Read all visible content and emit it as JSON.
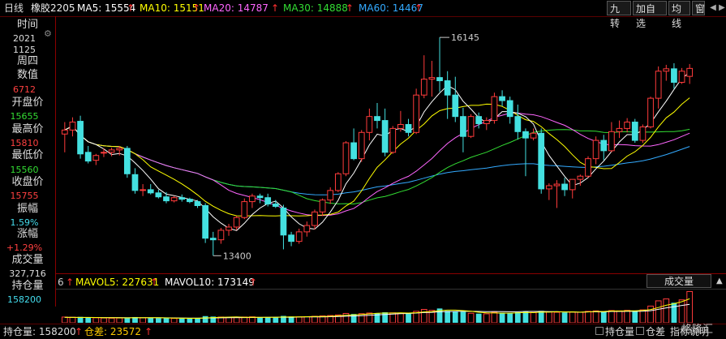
{
  "header": {
    "period": "日线",
    "symbol": "橡胶2205",
    "ma": [
      {
        "label": "MA5: 15554",
        "color": "#ffffff"
      },
      {
        "label": "MA10: 15151",
        "color": "#ffff00"
      },
      {
        "label": "MA20: 14787",
        "color": "#ff66ff"
      },
      {
        "label": "MA30: 14888",
        "color": "#33dd33"
      },
      {
        "label": "MA60: 14467",
        "color": "#33aaff"
      }
    ],
    "buttons": [
      "九转",
      "加自选",
      "均线",
      "窗"
    ]
  },
  "sidebar": {
    "time_label": "时间",
    "year": "2021",
    "date": "1125",
    "weekday": "周四",
    "value_label": "数值",
    "value": "6712",
    "open_label": "开盘价",
    "open": "15655",
    "high_label": "最高价",
    "high": "15810",
    "low_label": "最低价",
    "low": "15560",
    "close_label": "收盘价",
    "close": "15755",
    "amp_label": "振幅",
    "amp": "1.59%",
    "chg_label": "涨幅",
    "chg": "+1.29%",
    "vol_label": "成交量",
    "vol": "327,716",
    "oi_label": "持仓量",
    "oi": "158200"
  },
  "volume": {
    "prefix": "6",
    "mavol5": "MAVOL5: 227631",
    "mavol10": "MAVOL10: 173149",
    "indicator": "成交量"
  },
  "bottom": {
    "oi_text": "持仓量: 158200",
    "oi_change_text": "仓差: 23572",
    "oi_checkbox": "持仓量",
    "vol_checkbox": "仓差",
    "help": "指标说明",
    "brand": "格隆汇"
  },
  "colors": {
    "up": "#ff3b3b",
    "down": "#44e0e0",
    "ma5": "#ffffff",
    "ma10": "#ffff00",
    "ma20": "#ff66ff",
    "ma30": "#33dd33",
    "ma60": "#33aaff"
  },
  "chart_data": {
    "type": "candlestick",
    "annotations": [
      {
        "text": "16145",
        "price": 16145
      },
      {
        "text": "13400",
        "price": 13400
      }
    ],
    "price_range": [
      13250,
      16350
    ],
    "candles": [
      {
        "o": 14930,
        "h": 15080,
        "l": 14700,
        "c": 14980
      },
      {
        "o": 14980,
        "h": 15140,
        "l": 14900,
        "c": 15080
      },
      {
        "o": 15090,
        "h": 15160,
        "l": 14620,
        "c": 14680
      },
      {
        "o": 14700,
        "h": 14780,
        "l": 14560,
        "c": 14590
      },
      {
        "o": 14600,
        "h": 14680,
        "l": 14540,
        "c": 14660
      },
      {
        "o": 14690,
        "h": 14750,
        "l": 14640,
        "c": 14700
      },
      {
        "o": 14700,
        "h": 14760,
        "l": 14650,
        "c": 14730
      },
      {
        "o": 14730,
        "h": 14780,
        "l": 14660,
        "c": 14750
      },
      {
        "o": 14750,
        "h": 14780,
        "l": 14380,
        "c": 14430
      },
      {
        "o": 14420,
        "h": 14500,
        "l": 14180,
        "c": 14220
      },
      {
        "o": 14220,
        "h": 14300,
        "l": 14150,
        "c": 14230
      },
      {
        "o": 14230,
        "h": 14300,
        "l": 14170,
        "c": 14190
      },
      {
        "o": 14190,
        "h": 14230,
        "l": 14120,
        "c": 14140
      },
      {
        "o": 14140,
        "h": 14200,
        "l": 14060,
        "c": 14090
      },
      {
        "o": 14090,
        "h": 14150,
        "l": 14070,
        "c": 14130
      },
      {
        "o": 14130,
        "h": 14170,
        "l": 14080,
        "c": 14110
      },
      {
        "o": 14110,
        "h": 14130,
        "l": 14060,
        "c": 14080
      },
      {
        "o": 14080,
        "h": 14100,
        "l": 14000,
        "c": 14030
      },
      {
        "o": 14030,
        "h": 14060,
        "l": 13560,
        "c": 13620
      },
      {
        "o": 13620,
        "h": 13700,
        "l": 13400,
        "c": 13600
      },
      {
        "o": 13600,
        "h": 13750,
        "l": 13550,
        "c": 13720
      },
      {
        "o": 13720,
        "h": 13800,
        "l": 13650,
        "c": 13760
      },
      {
        "o": 13760,
        "h": 13900,
        "l": 13720,
        "c": 13880
      },
      {
        "o": 13880,
        "h": 14120,
        "l": 13860,
        "c": 14080
      },
      {
        "o": 14080,
        "h": 14180,
        "l": 14000,
        "c": 14150
      },
      {
        "o": 14150,
        "h": 14180,
        "l": 14060,
        "c": 14130
      },
      {
        "o": 14130,
        "h": 14180,
        "l": 14020,
        "c": 14050
      },
      {
        "o": 14050,
        "h": 14100,
        "l": 14000,
        "c": 14020
      },
      {
        "o": 14000,
        "h": 14040,
        "l": 13480,
        "c": 13660
      },
      {
        "o": 13660,
        "h": 13700,
        "l": 13520,
        "c": 13580
      },
      {
        "o": 13580,
        "h": 13740,
        "l": 13550,
        "c": 13700
      },
      {
        "o": 13700,
        "h": 13830,
        "l": 13640,
        "c": 13780
      },
      {
        "o": 13780,
        "h": 13980,
        "l": 13730,
        "c": 13950
      },
      {
        "o": 13950,
        "h": 14120,
        "l": 13900,
        "c": 14100
      },
      {
        "o": 14100,
        "h": 14260,
        "l": 14050,
        "c": 14220
      },
      {
        "o": 14220,
        "h": 14450,
        "l": 14200,
        "c": 14430
      },
      {
        "o": 14430,
        "h": 14840,
        "l": 14400,
        "c": 14820
      },
      {
        "o": 14820,
        "h": 15000,
        "l": 14600,
        "c": 14620
      },
      {
        "o": 14620,
        "h": 14980,
        "l": 14580,
        "c": 14950
      },
      {
        "o": 14950,
        "h": 15250,
        "l": 14850,
        "c": 15150
      },
      {
        "o": 15150,
        "h": 15320,
        "l": 15000,
        "c": 15100
      },
      {
        "o": 15100,
        "h": 15250,
        "l": 14650,
        "c": 14700
      },
      {
        "o": 14700,
        "h": 15030,
        "l": 14680,
        "c": 15000
      },
      {
        "o": 15000,
        "h": 15220,
        "l": 14960,
        "c": 15050
      },
      {
        "o": 15050,
        "h": 15120,
        "l": 14900,
        "c": 14950
      },
      {
        "o": 14950,
        "h": 15500,
        "l": 14930,
        "c": 15420
      },
      {
        "o": 15420,
        "h": 15920,
        "l": 15380,
        "c": 15620
      },
      {
        "o": 15620,
        "h": 15850,
        "l": 15400,
        "c": 15640
      },
      {
        "o": 15640,
        "h": 16145,
        "l": 15460,
        "c": 15600
      },
      {
        "o": 15600,
        "h": 15720,
        "l": 15120,
        "c": 15420
      },
      {
        "o": 15420,
        "h": 15650,
        "l": 15080,
        "c": 15150
      },
      {
        "o": 15150,
        "h": 15260,
        "l": 14700,
        "c": 14900
      },
      {
        "o": 14900,
        "h": 15180,
        "l": 14880,
        "c": 15150
      },
      {
        "o": 15150,
        "h": 15200,
        "l": 15000,
        "c": 15060
      },
      {
        "o": 15060,
        "h": 15140,
        "l": 14980,
        "c": 15100
      },
      {
        "o": 15100,
        "h": 15450,
        "l": 15060,
        "c": 15400
      },
      {
        "o": 15400,
        "h": 15480,
        "l": 15280,
        "c": 15350
      },
      {
        "o": 15350,
        "h": 15400,
        "l": 15060,
        "c": 15150
      },
      {
        "o": 15150,
        "h": 15300,
        "l": 14860,
        "c": 14960
      },
      {
        "o": 14960,
        "h": 15000,
        "l": 14400,
        "c": 14880
      },
      {
        "o": 14880,
        "h": 15000,
        "l": 14850,
        "c": 14940
      },
      {
        "o": 14940,
        "h": 15000,
        "l": 14180,
        "c": 14240
      },
      {
        "o": 14240,
        "h": 14310,
        "l": 14100,
        "c": 14280
      },
      {
        "o": 14280,
        "h": 14350,
        "l": 14000,
        "c": 14300
      },
      {
        "o": 14300,
        "h": 14380,
        "l": 14150,
        "c": 14230
      },
      {
        "o": 14230,
        "h": 14300,
        "l": 14120,
        "c": 14360
      },
      {
        "o": 14360,
        "h": 14420,
        "l": 14280,
        "c": 14400
      },
      {
        "o": 14400,
        "h": 14650,
        "l": 14380,
        "c": 14620
      },
      {
        "o": 14620,
        "h": 14900,
        "l": 14550,
        "c": 14850
      },
      {
        "o": 14850,
        "h": 14920,
        "l": 14600,
        "c": 14720
      },
      {
        "o": 14720,
        "h": 15080,
        "l": 14700,
        "c": 14960
      },
      {
        "o": 14960,
        "h": 15100,
        "l": 14880,
        "c": 15000
      },
      {
        "o": 15000,
        "h": 15130,
        "l": 14950,
        "c": 15080
      },
      {
        "o": 15080,
        "h": 15120,
        "l": 14820,
        "c": 14850
      },
      {
        "o": 14850,
        "h": 15050,
        "l": 14820,
        "c": 15020
      },
      {
        "o": 15020,
        "h": 15400,
        "l": 15000,
        "c": 15380
      },
      {
        "o": 15380,
        "h": 15780,
        "l": 15250,
        "c": 15720
      },
      {
        "o": 15720,
        "h": 15800,
        "l": 15600,
        "c": 15750
      },
      {
        "o": 15750,
        "h": 15820,
        "l": 15500,
        "c": 15580
      },
      {
        "o": 15580,
        "h": 15760,
        "l": 15560,
        "c": 15720
      },
      {
        "o": 15655,
        "h": 15810,
        "l": 15560,
        "c": 15755
      }
    ],
    "volume_max": 340000,
    "volumes": [
      60000,
      58000,
      62000,
      55000,
      52000,
      50000,
      48000,
      50000,
      55000,
      60000,
      52000,
      50000,
      48000,
      47000,
      46000,
      45000,
      46000,
      48000,
      70000,
      65000,
      60000,
      56000,
      54000,
      60000,
      62000,
      58000,
      56000,
      55000,
      72000,
      66000,
      62000,
      64000,
      68000,
      72000,
      76000,
      82000,
      98000,
      92000,
      95000,
      102000,
      100000,
      110000,
      104000,
      98000,
      96000,
      120000,
      140000,
      130000,
      150000,
      125000,
      118000,
      115000,
      100000,
      96000,
      94000,
      110000,
      105000,
      100000,
      110000,
      118000,
      108000,
      125000,
      115000,
      110000,
      108000,
      112000,
      110000,
      120000,
      125000,
      118000,
      128000,
      125000,
      130000,
      128000,
      135000,
      175000,
      230000,
      250000,
      210000,
      240000,
      327716
    ],
    "mavol5_line": [
      57000,
      56500,
      56000,
      56000,
      55500,
      53800,
      53400,
      52000,
      51000,
      52600,
      53000,
      53400,
      53000,
      51400,
      48600,
      47200,
      46400,
      46400,
      50800,
      54800,
      57800,
      59800,
      61000,
      57000,
      58400,
      58000,
      57400,
      57200,
      60600,
      61400,
      62200,
      63800,
      66400,
      66400,
      68400,
      72800,
      78800,
      84400,
      86800,
      93800,
      99400,
      101800,
      102200,
      104200,
      101600,
      105600,
      113600,
      117600,
      127200,
      133000,
      132600,
      127600,
      121600,
      110800,
      104600,
      103000,
      101000,
      101000,
      103800,
      108600,
      106200,
      112200,
      111200,
      115200,
      113200,
      114000,
      111000,
      114000,
      119000,
      118000,
      124000,
      123400,
      125400,
      125800,
      129400,
      138600,
      159600,
      183600,
      200000,
      221000,
      251543
    ],
    "mavol10_line": [
      56000,
      55800,
      55600,
      55400,
      55000,
      54800,
      54600,
      54000,
      53400,
      53200,
      53000,
      52800,
      52400,
      51800,
      50800,
      49800,
      48800,
      48400,
      49600,
      51200,
      52200,
      53600,
      54600,
      54200,
      55400,
      56400,
      57800,
      58600,
      58800,
      58200,
      60200,
      61000,
      61900,
      61900,
      63600,
      65600,
      68500,
      71100,
      73600,
      78400,
      83600,
      87600,
      91800,
      95500,
      97400,
      101800,
      107200,
      109800,
      115200,
      117400,
      119000,
      120600,
      119600,
      118900,
      117600,
      117800,
      117200,
      116000,
      115700,
      118800,
      118600,
      119400,
      117400,
      117100,
      113900,
      113700,
      110600,
      114400,
      114600,
      113800,
      119000,
      118700,
      119700,
      119700,
      121300,
      126300,
      141000,
      156000,
      168000,
      182000,
      193544
    ]
  }
}
